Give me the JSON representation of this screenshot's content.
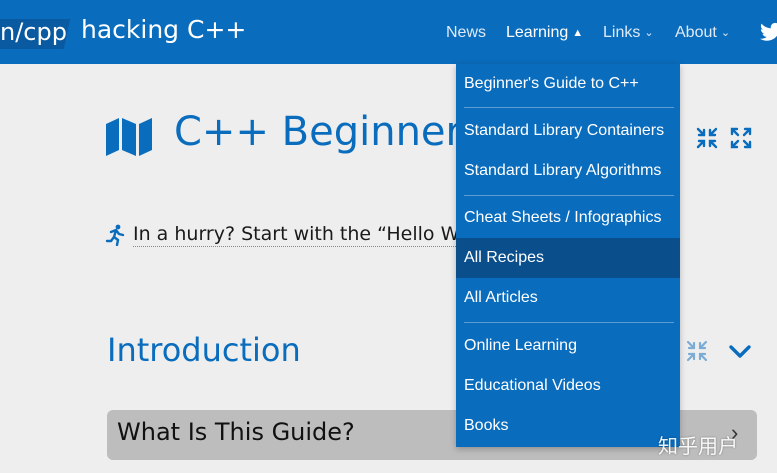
{
  "header": {
    "logo_text": "n/cpp",
    "site_title": "hacking C++",
    "nav": [
      {
        "label": "News",
        "active": false,
        "caret": ""
      },
      {
        "label": "Learning",
        "active": true,
        "caret": "up"
      },
      {
        "label": "Links",
        "active": false,
        "caret": "down"
      },
      {
        "label": "About",
        "active": false,
        "caret": "down"
      }
    ]
  },
  "main": {
    "page_title": "C++ Beginner's",
    "hurry_text": "In a hurry? Start with the “Hello Wo",
    "intro_heading": "Introduction",
    "guide_heading": "What Is This Guide?"
  },
  "dropdown": {
    "items": [
      {
        "label": "Beginner's Guide to C++"
      },
      {
        "label": "Standard Library Containers"
      },
      {
        "label": "Standard Library Algorithms"
      },
      {
        "label": "Cheat Sheets / Infographics"
      },
      {
        "label": "All Recipes",
        "selected": true
      },
      {
        "label": "All Articles"
      },
      {
        "label": "Online Learning"
      },
      {
        "label": "Educational Videos"
      },
      {
        "label": "Books"
      }
    ]
  },
  "watermark": "知乎用户",
  "colors": {
    "brand_blue": "#0a6cbd",
    "selected_blue": "#0a4f8c",
    "background": "#eeeeee",
    "guide_bar": "#bdbdbd"
  },
  "icons": [
    "twitter-icon",
    "map-icon",
    "collapse-all-icon",
    "expand-all-icon",
    "runner-icon",
    "chevron-down-icon"
  ]
}
